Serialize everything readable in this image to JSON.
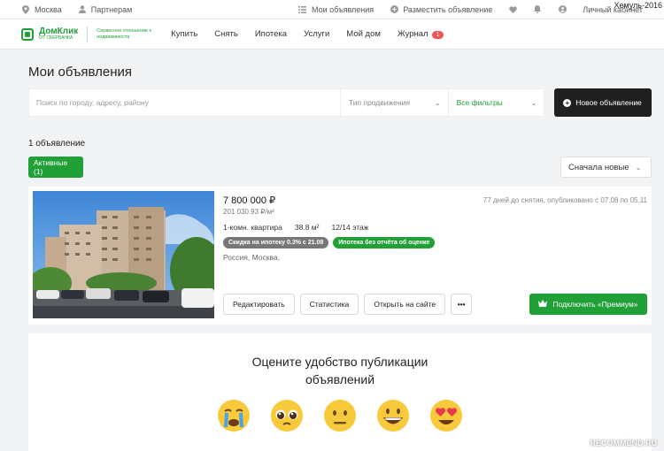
{
  "watermark_user": "Хемуль-2016",
  "watermark_site": "RECOMMEND.RU",
  "topbar": {
    "city": "Москва",
    "partners": "Партнерам",
    "my_ads": "Мои объявления",
    "post_ad": "Разместить объявление",
    "cabinet": "Личный кабинет"
  },
  "logo": {
    "name": "ДомКлик",
    "sub": "ОТ СБЕРБАНКА",
    "tagline": "Сервисное отношение к недвижимости"
  },
  "nav": {
    "items": [
      "Купить",
      "Снять",
      "Ипотека",
      "Услуги",
      "Мой дом"
    ],
    "journal": "Журнал",
    "journal_badge": "1"
  },
  "page": {
    "title": "Мои объявления",
    "search_placeholder": "Поиск по городу, адресу, району",
    "promo_type": "Тип продвижения",
    "all_filters": "Все фильтры",
    "new_ad": "Новое объявление",
    "count": "1 объявление",
    "tab_active": "Активные (1)",
    "sort": "Сначала новые"
  },
  "listing": {
    "price": "7 800 000 ₽",
    "price_per_m": "201 030.93 ₽/м²",
    "rooms": "1-комн. квартира",
    "area": "38.8 м²",
    "floor": "12/14 этаж",
    "tag_discount": "Скидка на ипотеку 0.3% с 21.08",
    "tag_no_report": "Ипотека без отчёта об оценке",
    "address": "Россия, Москва,",
    "days_info": "77 дней до снятия, опубликовано с 07.08 по 05.11",
    "btn_edit": "Редактировать",
    "btn_stats": "Статистика",
    "btn_open": "Открыть на сайте",
    "btn_more": "•••",
    "btn_premium": "Подключить «Премиум»"
  },
  "rating": {
    "title_line1": "Оцените удобство публикации",
    "title_line2": "объявлений",
    "emojis": [
      "crying-face",
      "pleading-face",
      "neutral-face",
      "grinning-face",
      "heart-eyes-face"
    ]
  },
  "colors": {
    "accent": "#21a038",
    "dark_button": "#1f1f1f",
    "badge_red": "#f05555"
  }
}
